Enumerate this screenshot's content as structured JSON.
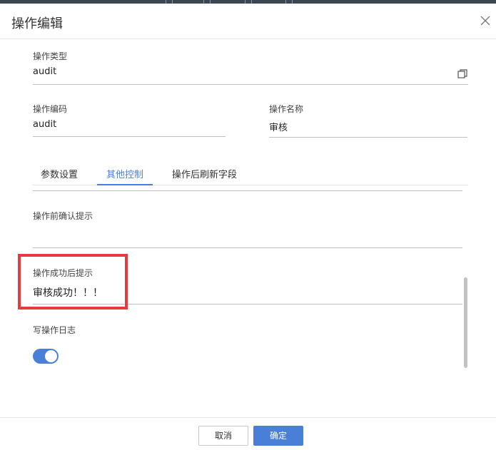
{
  "dialog": {
    "title": "操作编辑"
  },
  "fields": {
    "op_type": {
      "label": "操作类型",
      "value": "audit"
    },
    "op_code": {
      "label": "操作编码",
      "value": "audit"
    },
    "op_name": {
      "label": "操作名称",
      "value": "审核"
    }
  },
  "tabs": [
    {
      "label": "参数设置",
      "active": false
    },
    {
      "label": "其他控制",
      "active": true
    },
    {
      "label": "操作后刷新字段",
      "active": false
    }
  ],
  "other_control": {
    "pre_confirm": {
      "label": "操作前确认提示",
      "value": ""
    },
    "success_msg": {
      "label": "操作成功后提示",
      "value": "审核成功！！！"
    },
    "write_log": {
      "label": "写操作日志",
      "enabled": true
    }
  },
  "footer": {
    "cancel_label": "取消",
    "ok_label": "确定"
  },
  "colors": {
    "accent": "#4a7fd8",
    "highlight_box": "#e8393f"
  },
  "icons": {
    "close": "close-icon",
    "copy": "copy-icon"
  }
}
